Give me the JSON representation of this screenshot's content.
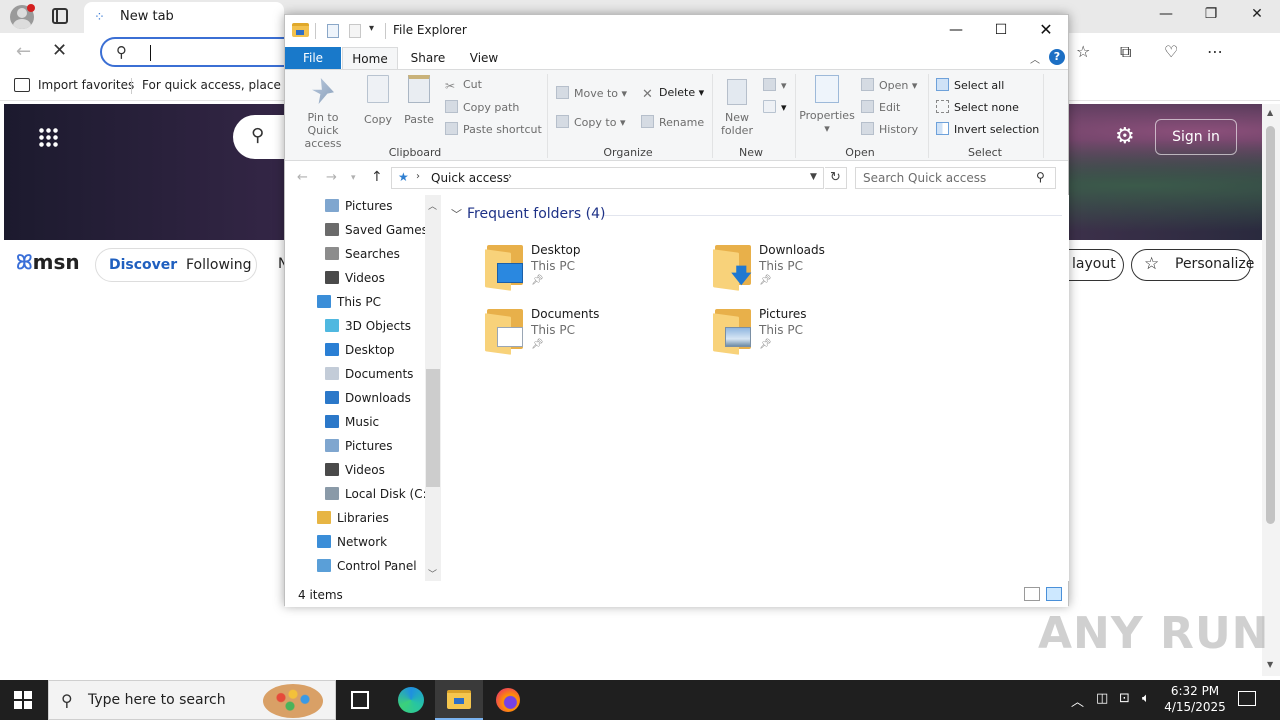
{
  "browser": {
    "tab_title": "New tab",
    "favorites": {
      "import_label": "Import favorites",
      "hint": "For quick access, place you"
    },
    "msn": {
      "logo": "msn",
      "sign_in": "Sign in",
      "pills": {
        "discover": "Discover",
        "following": "Following",
        "next_partial": "N"
      },
      "layout_partial": "layout",
      "personalize": "Personalize"
    },
    "watermark": "ANY RUN"
  },
  "explorer": {
    "title": "File Explorer",
    "ribbon_tabs": {
      "file": "File",
      "home": "Home",
      "share": "Share",
      "view": "View"
    },
    "ribbon": {
      "clipboard": {
        "label": "Clipboard",
        "pin": "Pin to Quick access",
        "copy": "Copy",
        "paste": "Paste",
        "cut": "Cut",
        "copy_path": "Copy path",
        "paste_shortcut": "Paste shortcut"
      },
      "organize": {
        "label": "Organize",
        "move_to": "Move to",
        "copy_to": "Copy to",
        "delete": "Delete",
        "rename": "Rename"
      },
      "new": {
        "label": "New",
        "new_folder_line1": "New",
        "new_folder_line2": "folder"
      },
      "open": {
        "label": "Open",
        "properties": "Properties",
        "open": "Open",
        "edit": "Edit",
        "history": "History"
      },
      "select": {
        "label": "Select",
        "select_all": "Select all",
        "select_none": "Select none",
        "invert": "Invert selection"
      }
    },
    "address": {
      "crumb": "Quick access",
      "search_placeholder": "Search Quick access"
    },
    "tree": [
      {
        "label": "Pictures",
        "indent": 1,
        "icon": "pictures-icon",
        "color": "#7fa6cf"
      },
      {
        "label": "Saved Games",
        "indent": 1,
        "icon": "saved-games-icon",
        "color": "#6b6b6b"
      },
      {
        "label": "Searches",
        "indent": 1,
        "icon": "search-icon",
        "color": "#8c8c8c"
      },
      {
        "label": "Videos",
        "indent": 1,
        "icon": "videos-icon",
        "color": "#4a4a4a"
      },
      {
        "label": "This PC",
        "indent": 0,
        "icon": "computer-icon",
        "color": "#3b8ed8"
      },
      {
        "label": "3D Objects",
        "indent": 1,
        "icon": "cube-icon",
        "color": "#4fb8e0"
      },
      {
        "label": "Desktop",
        "indent": 1,
        "icon": "desktop-icon",
        "color": "#2a7fd4"
      },
      {
        "label": "Documents",
        "indent": 1,
        "icon": "document-icon",
        "color": "#c3ccd8"
      },
      {
        "label": "Downloads",
        "indent": 1,
        "icon": "download-icon",
        "color": "#2b78c9"
      },
      {
        "label": "Music",
        "indent": 1,
        "icon": "music-icon",
        "color": "#2b78c9"
      },
      {
        "label": "Pictures",
        "indent": 1,
        "icon": "pictures-icon",
        "color": "#7fa6cf"
      },
      {
        "label": "Videos",
        "indent": 1,
        "icon": "videos-icon",
        "color": "#4a4a4a"
      },
      {
        "label": "Local Disk (C:)",
        "indent": 1,
        "icon": "drive-icon",
        "color": "#8a9aa8"
      },
      {
        "label": "Libraries",
        "indent": 0,
        "icon": "libraries-icon",
        "color": "#e7b544"
      },
      {
        "label": "Network",
        "indent": 0,
        "icon": "network-icon",
        "color": "#3b8ed8"
      },
      {
        "label": "Control Panel",
        "indent": 0,
        "icon": "control-panel-icon",
        "color": "#5a9fd8"
      }
    ],
    "group_header": "Frequent folders (4)",
    "folders": [
      {
        "name": "Desktop",
        "location": "This PC",
        "badge": "desktop"
      },
      {
        "name": "Downloads",
        "location": "This PC",
        "badge": "downloads"
      },
      {
        "name": "Documents",
        "location": "This PC",
        "badge": "documents"
      },
      {
        "name": "Pictures",
        "location": "This PC",
        "badge": "pictures"
      }
    ],
    "status": "4 items"
  },
  "taskbar": {
    "search_placeholder": "Type here to search",
    "time": "6:32 PM",
    "date": "4/15/2025"
  }
}
